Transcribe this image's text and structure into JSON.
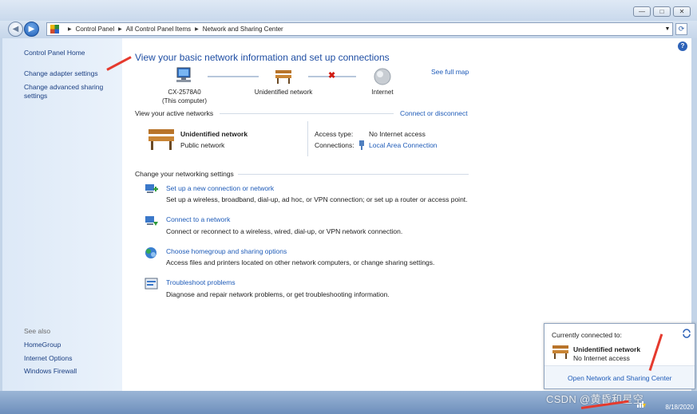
{
  "window": {
    "minimize_glyph": "—",
    "maximize_glyph": "□",
    "close_glyph": "✕"
  },
  "address_bar": {
    "back_glyph": "◀",
    "forward_glyph": "▶",
    "crumbs": [
      "Control Panel",
      "All Control Panel Items",
      "Network and Sharing Center"
    ],
    "separator": "▶",
    "dropdown_glyph": "▼",
    "refresh_glyph": "⟳"
  },
  "sidebar": {
    "home": "Control Panel Home",
    "links": [
      "Change adapter settings",
      "Change advanced sharing settings"
    ],
    "see_also_title": "See also",
    "see_also": [
      "HomeGroup",
      "Internet Options",
      "Windows Firewall"
    ]
  },
  "main": {
    "help_glyph": "?",
    "title": "View your basic network information and set up connections",
    "see_full_map": "See full map",
    "map": {
      "computer_name": "CX-2578A0",
      "computer_caption": "(This computer)",
      "network": "Unidentified network",
      "internet": "Internet",
      "broken_glyph": "✖"
    },
    "active_title": "View your active networks",
    "connect_link": "Connect or disconnect",
    "active_network": {
      "name": "Unidentified network",
      "type": "Public network",
      "access_label": "Access type:",
      "access_value": "No Internet access",
      "connections_label": "Connections:",
      "connections_value": "Local Area Connection"
    },
    "settings_title": "Change your networking settings",
    "tasks": [
      {
        "title": "Set up a new connection or network",
        "desc": "Set up a wireless, broadband, dial-up, ad hoc, or VPN connection; or set up a router or access point."
      },
      {
        "title": "Connect to a network",
        "desc": "Connect or reconnect to a wireless, wired, dial-up, or VPN network connection."
      },
      {
        "title": "Choose homegroup and sharing options",
        "desc": "Access files and printers located on other network computers, or change sharing settings."
      },
      {
        "title": "Troubleshoot problems",
        "desc": "Diagnose and repair network problems, or get troubleshooting information."
      }
    ]
  },
  "popup": {
    "title": "Currently connected to:",
    "network_name": "Unidentified network",
    "network_status": "No Internet access",
    "open_link": "Open Network and Sharing Center"
  },
  "taskbar": {
    "date": "8/18/2020"
  },
  "watermark": "CSDN @黄昏和星空",
  "colors": {
    "link": "#1e5bb8",
    "title": "#1f4ea3",
    "annotation_arrow": "#e53a2e"
  }
}
